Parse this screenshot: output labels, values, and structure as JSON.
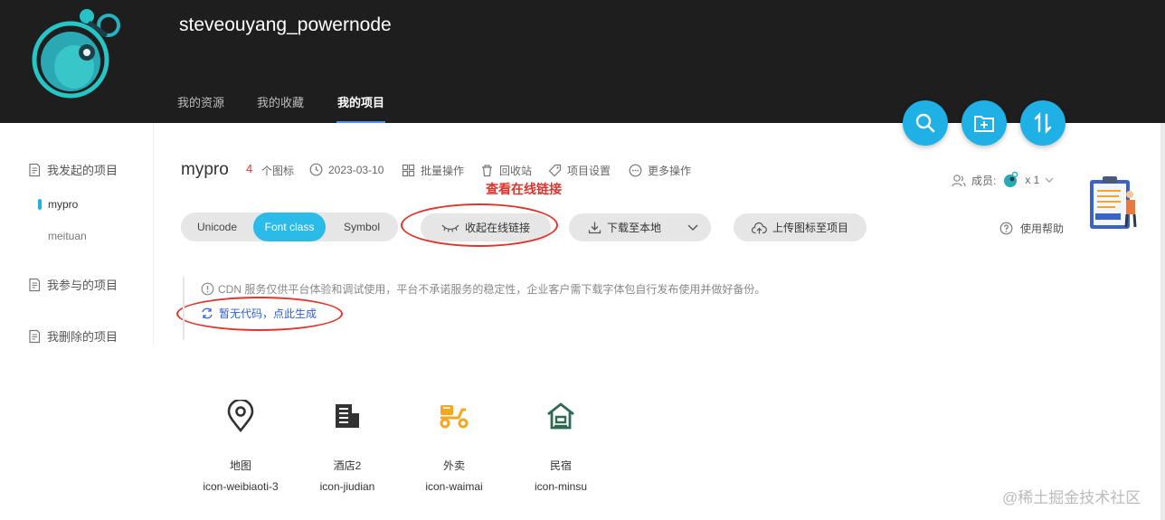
{
  "header": {
    "username": "steveouyang_powernode",
    "tabs": [
      {
        "label": "我的资源"
      },
      {
        "label": "我的收藏"
      },
      {
        "label": "我的项目"
      }
    ]
  },
  "sidebar": {
    "initiated": "我发起的项目",
    "projects": [
      "mypro",
      "meituan"
    ],
    "participated": "我参与的项目",
    "deleted": "我删除的项目"
  },
  "project": {
    "name": "mypro",
    "count": "4",
    "count_unit": "个图标",
    "date": "2023-03-10",
    "batch": "批量操作",
    "recycle": "回收站",
    "settings": "项目设置",
    "more": "更多操作",
    "members_label": "成员:",
    "members_count": "x 1"
  },
  "toolbar": {
    "unicode": "Unicode",
    "fontclass": "Font class",
    "symbol": "Symbol",
    "collapse_link": "收起在线链接",
    "download": "下载至本地",
    "upload": "上传图标至项目",
    "help": "使用帮助"
  },
  "annotation": "查看在线链接",
  "notice": "CDN 服务仅供平台体验和调试使用，平台不承诺服务的稳定性，企业客户需下载字体包自行发布使用并做好备份。",
  "generate": "暂无代码，点此生成",
  "icons": [
    {
      "name": "地图",
      "code": "icon-weibiaoti-3",
      "icon": "map-pin-icon"
    },
    {
      "name": "酒店2",
      "code": "icon-jiudian",
      "icon": "hotel-icon"
    },
    {
      "name": "外卖",
      "code": "icon-waimai",
      "icon": "delivery-scooter-icon"
    },
    {
      "name": "民宿",
      "code": "icon-minsu",
      "icon": "homestay-icon"
    }
  ],
  "watermark": "@稀土掘金技术社区",
  "colors": {
    "accent": "#1fb1e6",
    "annotation": "#e0332b",
    "link": "#2f5fd8"
  }
}
